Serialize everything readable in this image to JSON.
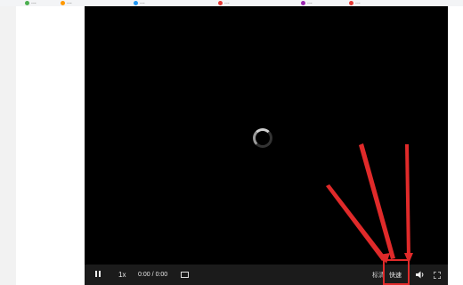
{
  "browser": {
    "bookmarks": [
      {
        "label": "...",
        "color": "#4caf50"
      },
      {
        "label": "...",
        "color": "#ff9800"
      },
      {
        "label": "...",
        "color": "#2196f3"
      },
      {
        "label": "...",
        "color": "#e53935"
      },
      {
        "label": "...",
        "color": "#9c27b0"
      },
      {
        "label": "...",
        "color": "#e53935"
      }
    ]
  },
  "player": {
    "state": "loading",
    "controls": {
      "speed_label": "1x",
      "current_time": "0:00",
      "separator": "/",
      "duration": "0:00",
      "quality_label": "标清",
      "mode_label": "快速"
    }
  },
  "annotation": {
    "arrow_color": "#e02a2a",
    "highlight_target": "mode_label"
  },
  "icons": [
    "pause-icon",
    "screenshot-icon",
    "volume-icon",
    "fullscreen-icon",
    "loading-spinner"
  ]
}
